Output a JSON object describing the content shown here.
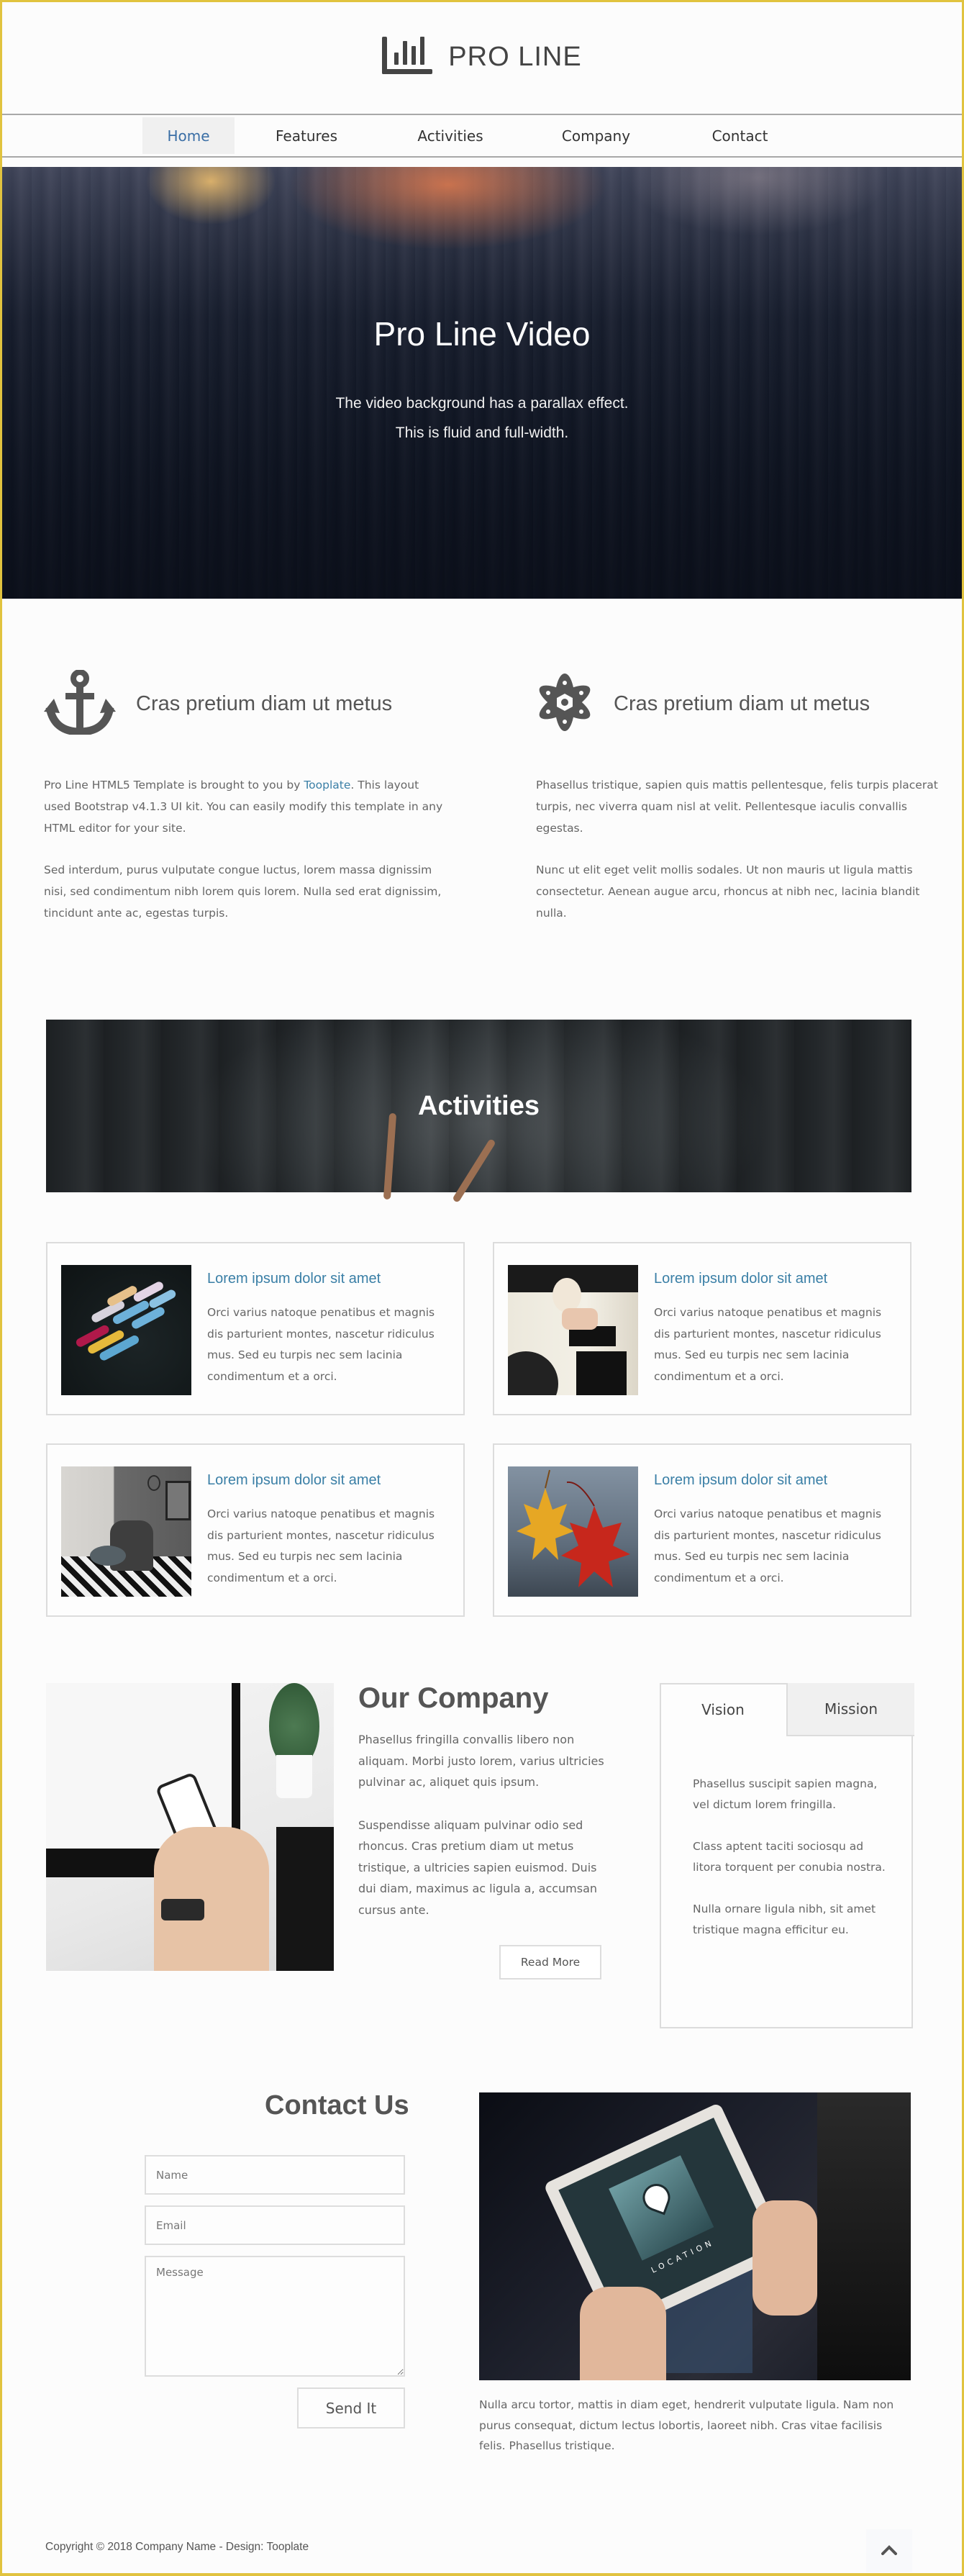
{
  "brand": {
    "name": "PRO LINE",
    "icon": "bar-chart-icon"
  },
  "nav": {
    "items": [
      {
        "label": "Home",
        "active": true
      },
      {
        "label": "Features",
        "active": false
      },
      {
        "label": "Activities",
        "active": false
      },
      {
        "label": "Company",
        "active": false
      },
      {
        "label": "Contact",
        "active": false
      }
    ]
  },
  "hero": {
    "title": "Pro Line Video",
    "line1": "The video background has a parallax effect.",
    "line2": "This is fluid and full-width."
  },
  "features": [
    {
      "icon": "anchor-icon",
      "title": "Cras pretium diam ut metus",
      "p1_before": "Pro Line HTML5 Template is brought to you by ",
      "p1_link": "Tooplate",
      "p1_after": ". This layout used Bootstrap v4.1.3 UI kit. You can easily modify this template in any HTML editor for your site.",
      "p2": "Sed interdum, purus vulputate congue luctus, lorem massa dignissim nisi, sed condimentum nibh lorem quis lorem. Nulla sed erat dignissim, tincidunt ante ac, egestas turpis."
    },
    {
      "icon": "atom-icon",
      "title": "Cras pretium diam ut metus",
      "p1": "Phasellus tristique, sapien quis mattis pellentesque, felis turpis placerat turpis, nec viverra quam nisl at velit. Pellentesque iaculis convallis egestas.",
      "p2": "Nunc ut elit eget velit mollis sodales. Ut non mauris ut ligula mattis consectetur. Aenean augue arcu, rhoncus at nibh nec, lacinia blandit nulla."
    }
  ],
  "activities": {
    "title": "Activities",
    "cards": [
      {
        "title": "Lorem ipsum dolor sit amet",
        "text": "Orci varius natoque penatibus et magnis dis parturient montes, nascetur ridiculus mus. Sed eu turpis nec sem lacinia condimentum et a orci.",
        "image": "boats-photo"
      },
      {
        "title": "Lorem ipsum dolor sit amet",
        "text": "Orci varius natoque penatibus et magnis dis parturient montes, nascetur ridiculus mus. Sed eu turpis nec sem lacinia condimentum et a orci.",
        "image": "woman-van-photo"
      },
      {
        "title": "Lorem ipsum dolor sit amet",
        "text": "Orci varius natoque penatibus et magnis dis parturient montes, nascetur ridiculus mus. Sed eu turpis nec sem lacinia condimentum et a orci.",
        "image": "interior-chair-photo"
      },
      {
        "title": "Lorem ipsum dolor sit amet",
        "text": "Orci varius natoque penatibus et magnis dis parturient montes, nascetur ridiculus mus. Sed eu turpis nec sem lacinia condimentum et a orci.",
        "image": "maple-leaves-photo"
      }
    ]
  },
  "company": {
    "title": "Our Company",
    "p1": "Phasellus fringilla convallis libero non aliquam. Morbi justo lorem, varius ultricies pulvinar ac, aliquet quis ipsum.",
    "p2": "Suspendisse aliquam pulvinar odio sed rhoncus. Cras pretium diam ut metus tristique, a ultricies sapien euismod. Duis dui diam, maximus ac ligula a, accumsan cursus ante.",
    "read_more": "Read More",
    "tabs": [
      {
        "label": "Vision",
        "active": true
      },
      {
        "label": "Mission",
        "active": false
      }
    ],
    "tab_content": [
      "Phasellus suscipit sapien magna, vel dictum lorem fringilla.",
      "Class aptent taciti sociosqu ad litora torquent per conubia nostra.",
      "Nulla ornare ligula nibh, sit amet tristique magna efficitur eu."
    ]
  },
  "contact": {
    "title": "Contact Us",
    "name_placeholder": "Name",
    "email_placeholder": "Email",
    "message_placeholder": "Message",
    "send_label": "Send It",
    "image_label": "LOCATION",
    "text": "Nulla arcu tortor, mattis in diam eget, hendrerit vulputate ligula. Nam non purus consequat, dictum lectus lobortis, laoreet nibh. Cras vitae facilisis felis. Phasellus tristique."
  },
  "footer": {
    "copyright": "Copyright © 2018 Company Name - Design: Tooplate",
    "back_to_top_icon": "chevron-up-icon"
  },
  "colors": {
    "accent": "#3a7fa6",
    "nav_active": "#3a6ea5",
    "page_border": "#e1c33f",
    "text": "#666666",
    "heading": "#555555"
  }
}
